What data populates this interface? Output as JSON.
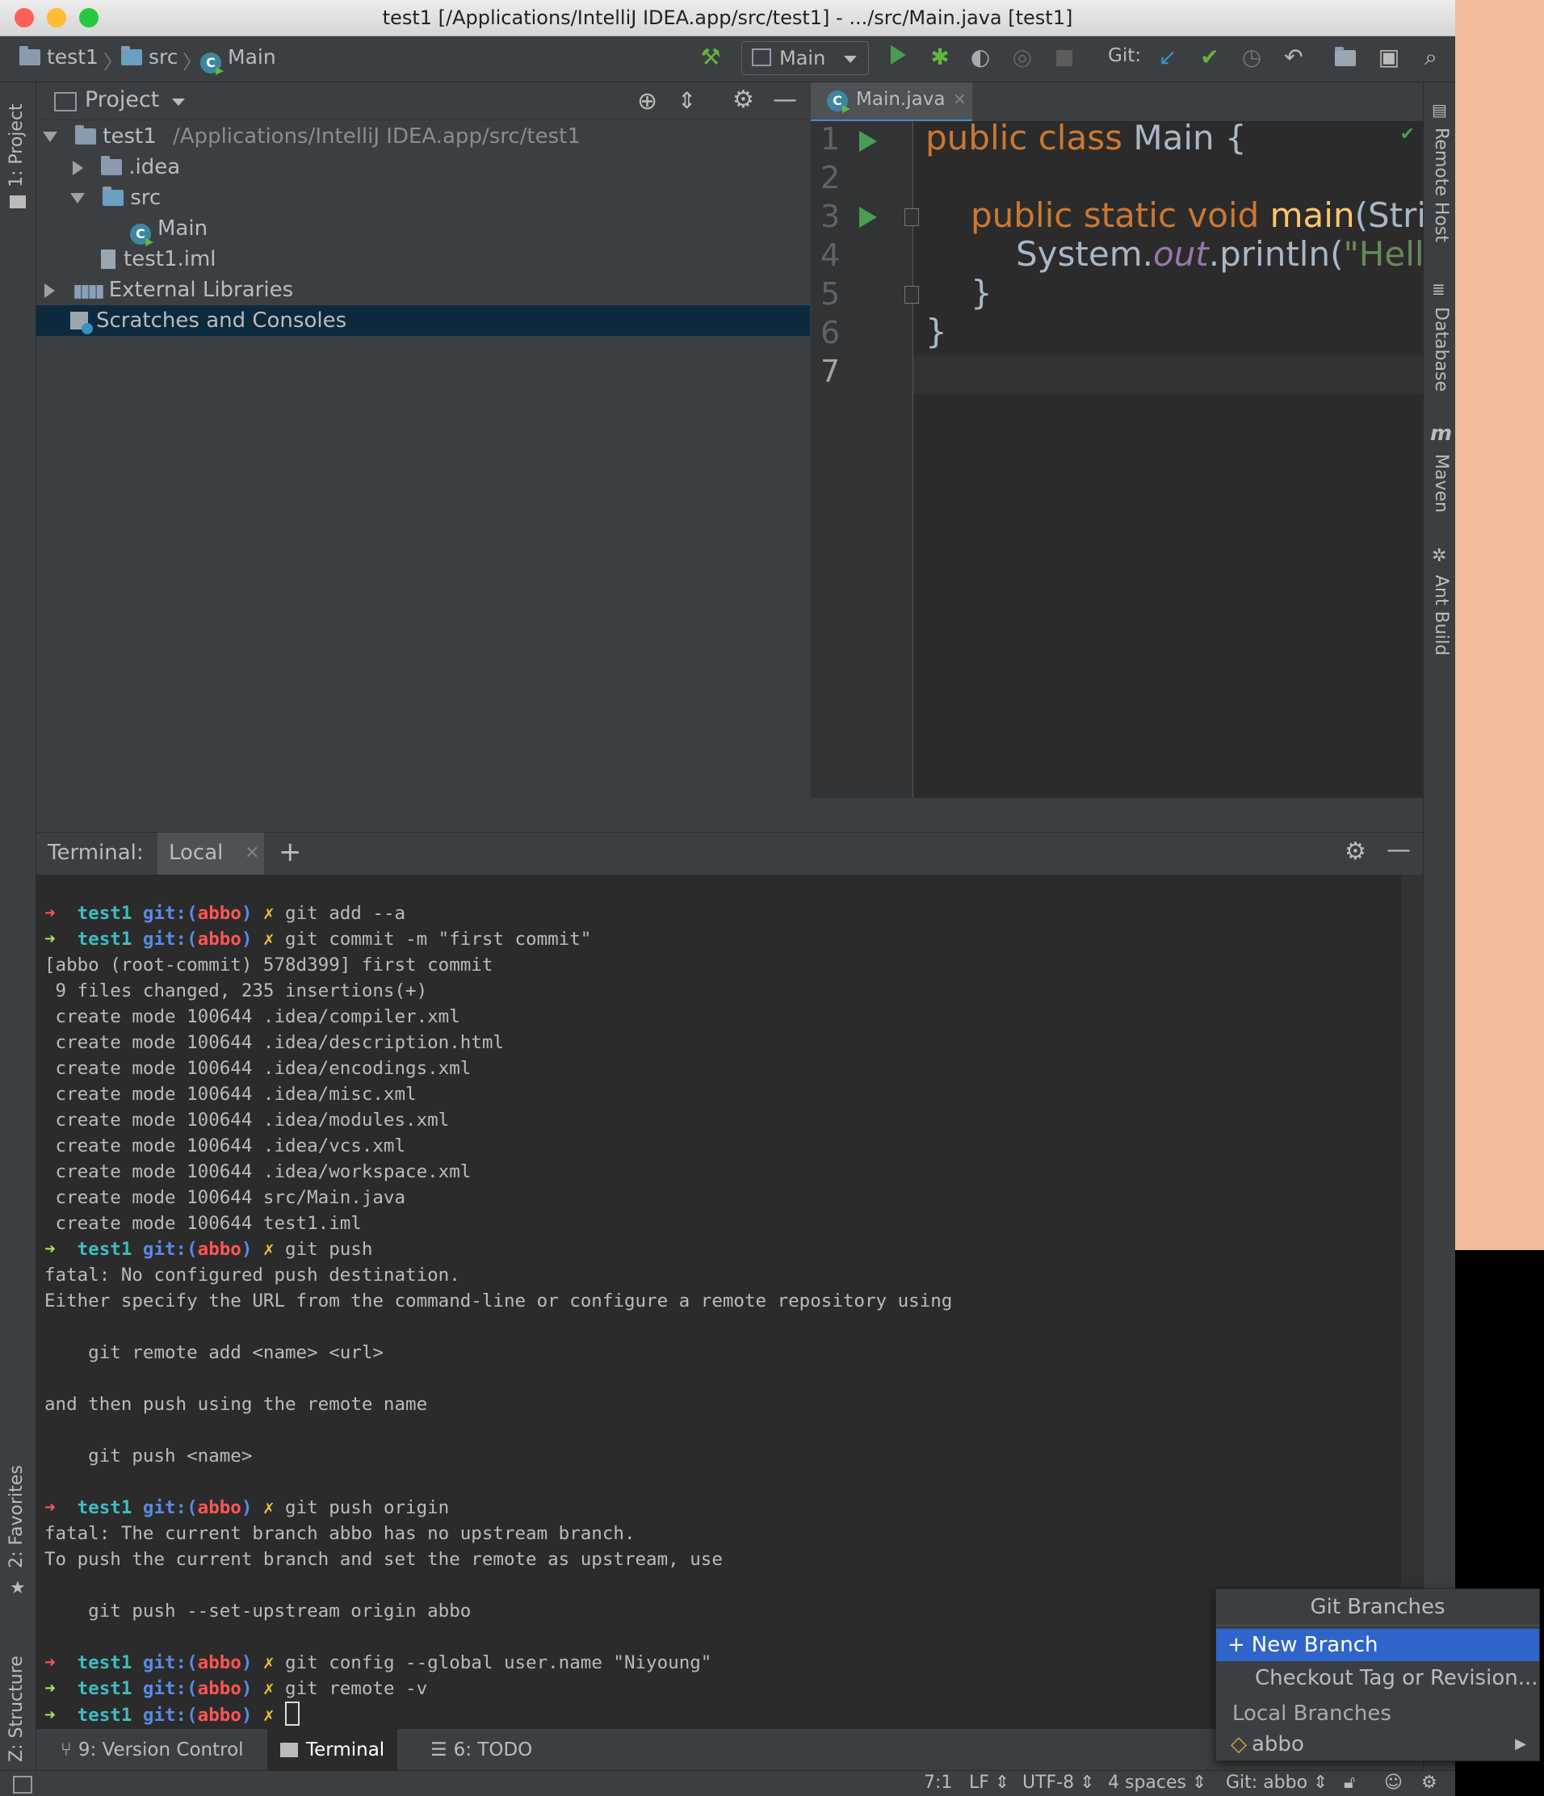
{
  "window": {
    "title": "test1 [/Applications/IntelliJ IDEA.app/src/test1] - .../src/Main.java [test1]"
  },
  "navbar": {
    "crumbs": [
      "test1",
      "src",
      "Main"
    ],
    "run_config": "Main",
    "git_label": "Git:"
  },
  "left_tabs": {
    "project": "1: Project",
    "favorites": "2: Favorites",
    "structure": "Z: Structure"
  },
  "right_tabs": {
    "remote_host": "Remote Host",
    "database": "Database",
    "maven": "Maven",
    "ant_build": "Ant Build"
  },
  "project": {
    "header": "Project",
    "tree": [
      {
        "label": "test1",
        "path": "/Applications/IntelliJ IDEA.app/src/test1"
      },
      {
        "label": ".idea"
      },
      {
        "label": "src"
      },
      {
        "label": "Main"
      },
      {
        "label": "test1.iml"
      },
      {
        "label": "External Libraries"
      },
      {
        "label": "Scratches and Consoles"
      }
    ]
  },
  "editor": {
    "tab": "Main.java",
    "line_numbers": [
      "1",
      "2",
      "3",
      "4",
      "5",
      "6",
      "7"
    ],
    "code": {
      "l1_kw": "public class ",
      "l1_rest": "Main {",
      "l3_kw": "public static void ",
      "l3_fn": "main",
      "l3_rest": "(Strin",
      "l4_a": "System.",
      "l4_field": "out",
      "l4_b": ".println(",
      "l4_str": "\"Hello",
      "l5": "}",
      "l6": "}"
    }
  },
  "terminal": {
    "label": "Terminal:",
    "tab": "Local",
    "prompt": {
      "dir": "test1",
      "git": "git:(",
      "branch": "abbo",
      "close": ")",
      "mark": "✗",
      "arrow": "➜"
    },
    "commands": [
      "git add --a",
      "git commit -m \"first commit\"",
      "git push",
      "git push origin",
      "git config --global user.name \"Niyoung\"",
      "git remote -v"
    ],
    "output": [
      "[abbo (root-commit) 578d399] first commit",
      " 9 files changed, 235 insertions(+)",
      " create mode 100644 .idea/compiler.xml",
      " create mode 100644 .idea/description.html",
      " create mode 100644 .idea/encodings.xml",
      " create mode 100644 .idea/misc.xml",
      " create mode 100644 .idea/modules.xml",
      " create mode 100644 .idea/vcs.xml",
      " create mode 100644 .idea/workspace.xml",
      " create mode 100644 src/Main.java",
      " create mode 100644 test1.iml",
      "fatal: No configured push destination.",
      "Either specify the URL from the command-line or configure a remote repository using",
      "    git remote add <name> <url>",
      "and then push using the remote name",
      "    git push <name>",
      "fatal: The current branch abbo has no upstream branch.",
      "To push the current branch and set the remote as upstream, use",
      "    git push --set-upstream origin abbo"
    ]
  },
  "bottom_tabs": {
    "version_control": "9: Version Control",
    "terminal": "Terminal",
    "todo": "6: TODO"
  },
  "status": {
    "position": "7:1",
    "line_sep": "LF",
    "encoding": "UTF-8",
    "indent": "4 spaces",
    "git": "Git: abbo"
  },
  "git_branches": {
    "title": "Git Branches",
    "new_branch": "New Branch",
    "checkout": "Checkout Tag or Revision...",
    "local_branches": "Local Branches",
    "branch": "abbo"
  },
  "colors": {
    "accent": "#2f65ca",
    "selection": "#0d293e",
    "keyword": "#cc7832",
    "string": "#6a8759",
    "run_green": "#499c54"
  }
}
